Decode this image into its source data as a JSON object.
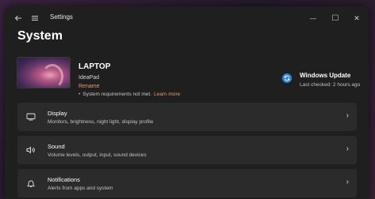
{
  "window": {
    "title": "Settings",
    "back_icon": "back-arrow-icon",
    "menu_icon": "hamburger-menu-icon",
    "minimize_glyph": "—",
    "maximize_glyph": "☐",
    "close_glyph": "✕"
  },
  "page": {
    "title": "System"
  },
  "device": {
    "name": "LAPTOP",
    "model": "IdeaPad",
    "rename_label": "Rename",
    "warning_text": "System requirements not met.",
    "learn_more_label": "Learn more",
    "bullet": "•"
  },
  "windows_update": {
    "title": "Windows Update",
    "subtitle": "Last checked: 2 hours ago",
    "icon": "sync-icon"
  },
  "settings": [
    {
      "title": "Display",
      "subtitle": "Monitors, brightness, night light, display profile",
      "icon": "monitor-icon",
      "glyph": "▭"
    },
    {
      "title": "Sound",
      "subtitle": "Volume levels, output, input, sound devices",
      "icon": "speaker-icon",
      "glyph": "🔊"
    },
    {
      "title": "Notifications",
      "subtitle": "Alerts from apps and system",
      "icon": "bell-icon",
      "glyph": "🔔"
    }
  ],
  "colors": {
    "accent": "#e89b6c",
    "update_blue": "#2b88d8",
    "window_bg": "#1f1f1f",
    "card_bg": "#2b2b2b"
  }
}
